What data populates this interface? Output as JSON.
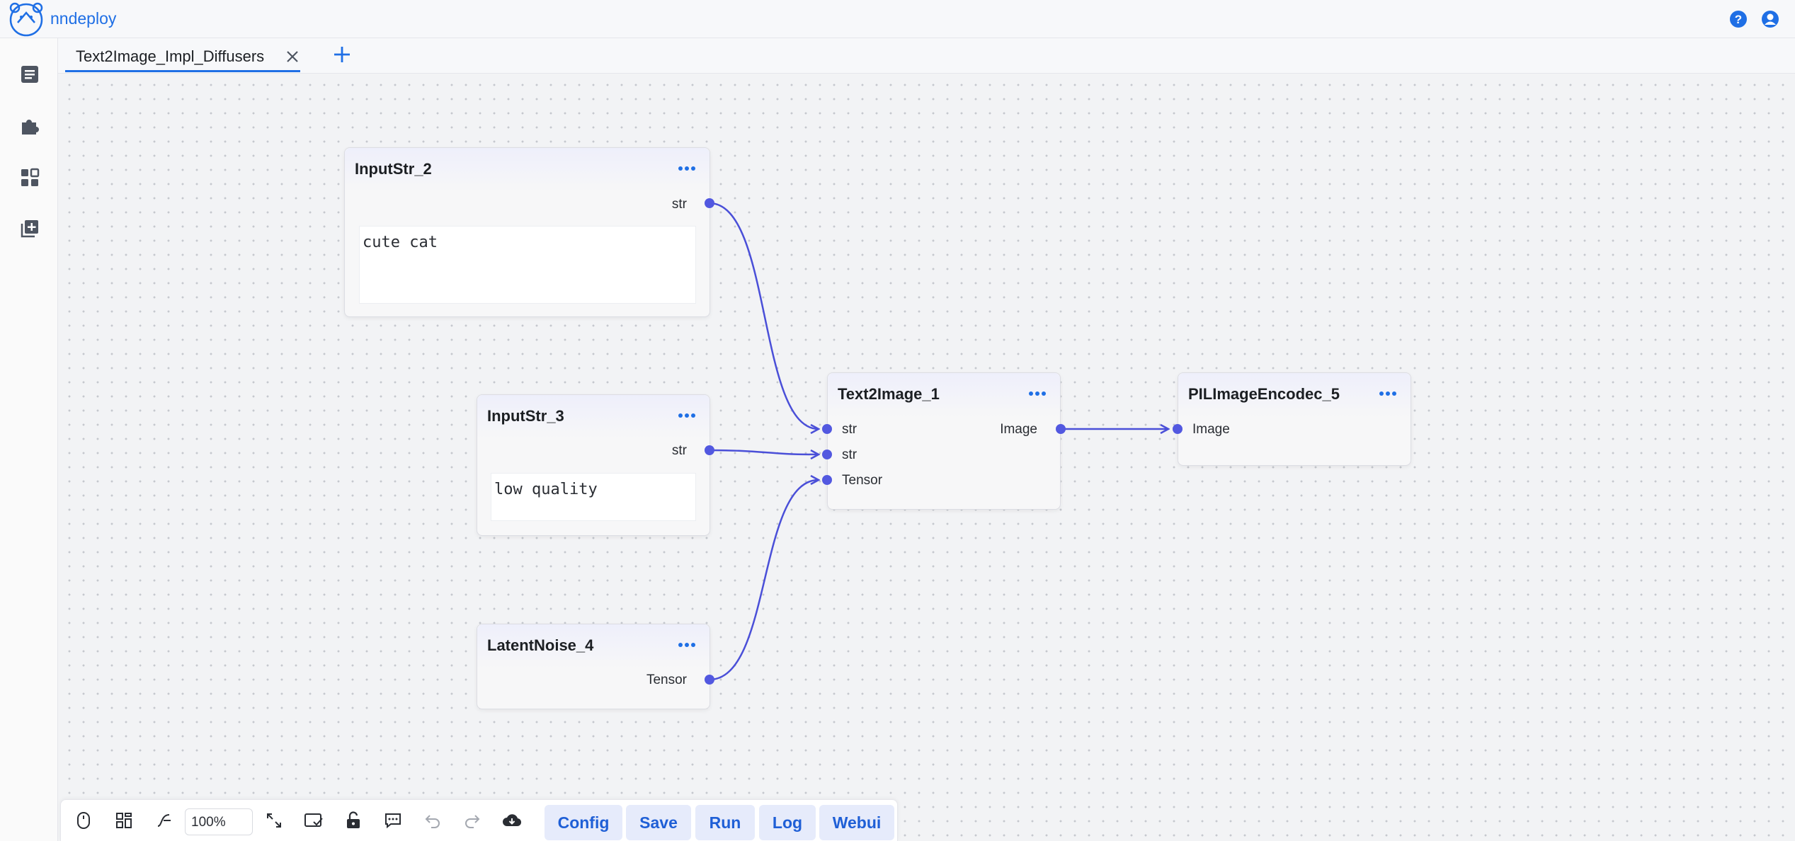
{
  "app": {
    "brand": "nndeploy",
    "logo_icon": "bear-logo-icon",
    "help_icon": "help-icon",
    "user_icon": "user-avatar-icon"
  },
  "sidebar": {
    "items": [
      {
        "name": "document",
        "icon": "document-icon"
      },
      {
        "name": "plugin",
        "icon": "puzzle-icon"
      },
      {
        "name": "nodes",
        "icon": "grid-icon"
      },
      {
        "name": "add-node",
        "icon": "add-layer-icon"
      }
    ]
  },
  "tabs": [
    {
      "label": "Text2Image_Impl_Diffusers",
      "closable": true
    }
  ],
  "nodes": {
    "input2": {
      "title": "InputStr_2",
      "out": "str",
      "text": "cute cat"
    },
    "input3": {
      "title": "InputStr_3",
      "out": "str",
      "text": "low quality"
    },
    "latent": {
      "title": "LatentNoise_4",
      "out": "Tensor"
    },
    "t2i": {
      "title": "Text2Image_1",
      "in": [
        "str",
        "str",
        "Tensor"
      ],
      "out": "Image"
    },
    "pil": {
      "title": "PILImageEncodec_5",
      "in": "Image"
    }
  },
  "toolbar": {
    "zoom": "100%",
    "buttons": {
      "config": "Config",
      "save": "Save",
      "run": "Run",
      "log": "Log",
      "webui": "Webui"
    }
  },
  "colors": {
    "accent": "#1f6fe5",
    "edge": "#4a4fd8",
    "port": "#5258e0",
    "button_bg": "#e6ebfb"
  }
}
